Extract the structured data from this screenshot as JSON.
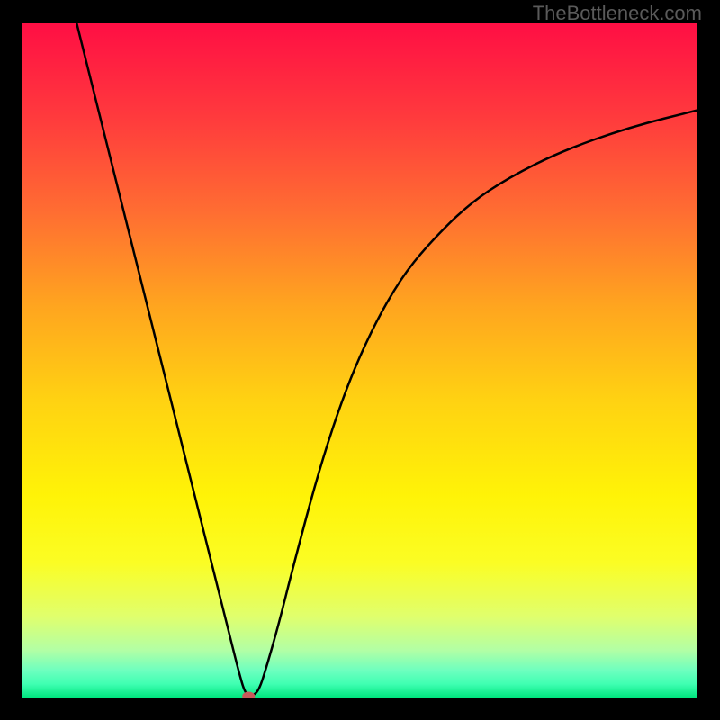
{
  "watermark": "TheBottleneck.com",
  "chart_data": {
    "type": "line",
    "title": "",
    "xlabel": "",
    "ylabel": "",
    "xlim": [
      0,
      100
    ],
    "ylim": [
      0,
      100
    ],
    "grid": false,
    "legend": false,
    "background_gradient": {
      "stops": [
        {
          "offset": 0.0,
          "color": "#ff0e44"
        },
        {
          "offset": 0.14,
          "color": "#ff3a3d"
        },
        {
          "offset": 0.28,
          "color": "#ff6d32"
        },
        {
          "offset": 0.42,
          "color": "#ffa51f"
        },
        {
          "offset": 0.56,
          "color": "#ffd212"
        },
        {
          "offset": 0.7,
          "color": "#fff307"
        },
        {
          "offset": 0.8,
          "color": "#fbfd24"
        },
        {
          "offset": 0.88,
          "color": "#e0ff6d"
        },
        {
          "offset": 0.93,
          "color": "#b2ffa5"
        },
        {
          "offset": 0.96,
          "color": "#6dffbf"
        },
        {
          "offset": 0.98,
          "color": "#3fffb2"
        },
        {
          "offset": 1.0,
          "color": "#00e57e"
        }
      ]
    },
    "series": [
      {
        "name": "bottleneck-curve",
        "x": [
          8,
          10,
          12,
          14,
          16,
          18,
          20,
          22,
          24,
          26,
          28,
          30,
          31,
          32,
          33,
          34,
          35,
          36,
          38,
          40,
          44,
          48,
          52,
          56,
          60,
          66,
          72,
          80,
          90,
          100
        ],
        "y": [
          100,
          92,
          84,
          76,
          68,
          60,
          52,
          44,
          36,
          28,
          20,
          12,
          8,
          4,
          0.5,
          0.2,
          1,
          4,
          11,
          19,
          34,
          46,
          55,
          62,
          67,
          73,
          77,
          81,
          84.5,
          87
        ],
        "color": "#000000"
      }
    ],
    "marker": {
      "name": "optimal-point",
      "x": 33.5,
      "y": 0.2,
      "color": "#c75a5a",
      "rx": 7,
      "ry": 5
    }
  }
}
